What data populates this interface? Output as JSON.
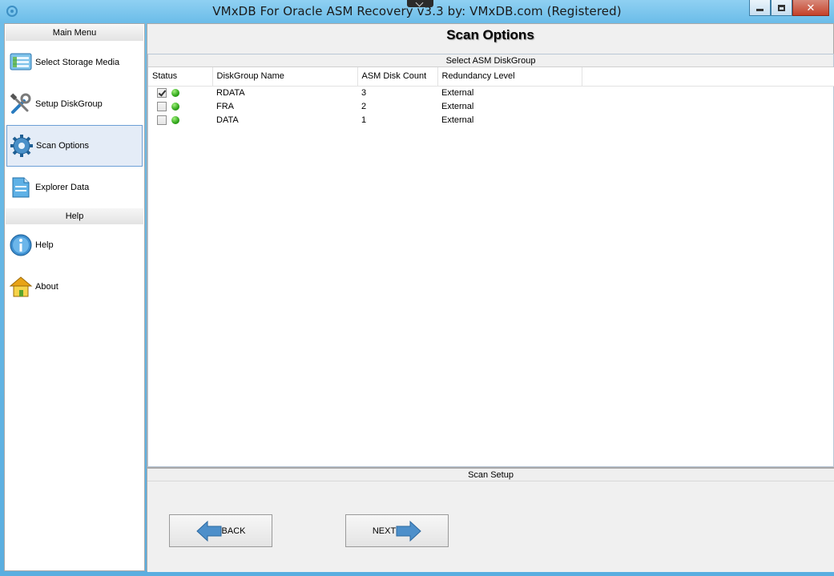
{
  "window": {
    "title": "VMxDB For Oracle ASM Recovery v3.3 by: VMxDB.com (Registered)"
  },
  "sidebar": {
    "main_menu_header": "Main Menu",
    "help_header": "Help",
    "items": [
      {
        "label": "Select Storage Media",
        "icon": "storage-media-icon"
      },
      {
        "label": "Setup DiskGroup",
        "icon": "tools-icon"
      },
      {
        "label": "Scan Options",
        "icon": "gear-icon"
      },
      {
        "label": "Explorer Data",
        "icon": "document-icon"
      }
    ],
    "help_items": [
      {
        "label": "Help",
        "icon": "info-icon"
      },
      {
        "label": "About",
        "icon": "home-icon"
      }
    ]
  },
  "main": {
    "page_title": "Scan Options",
    "group_title": "Select ASM DiskGroup",
    "columns": [
      "Status",
      "DiskGroup Name",
      "ASM Disk Count",
      "Redundancy Level"
    ],
    "rows": [
      {
        "checked": true,
        "name": "RDATA",
        "count": "3",
        "redundancy": "External"
      },
      {
        "checked": false,
        "name": "FRA",
        "count": "2",
        "redundancy": "External"
      },
      {
        "checked": false,
        "name": "DATA",
        "count": "1",
        "redundancy": "External"
      }
    ],
    "setup_title": "Scan Setup",
    "back_label": "BACK",
    "next_label": "NEXT"
  },
  "colors": {
    "status_ok": "#2fa51a",
    "active_item_bg": "#e4ecf7",
    "arrow_blue": "#3f84c4"
  }
}
